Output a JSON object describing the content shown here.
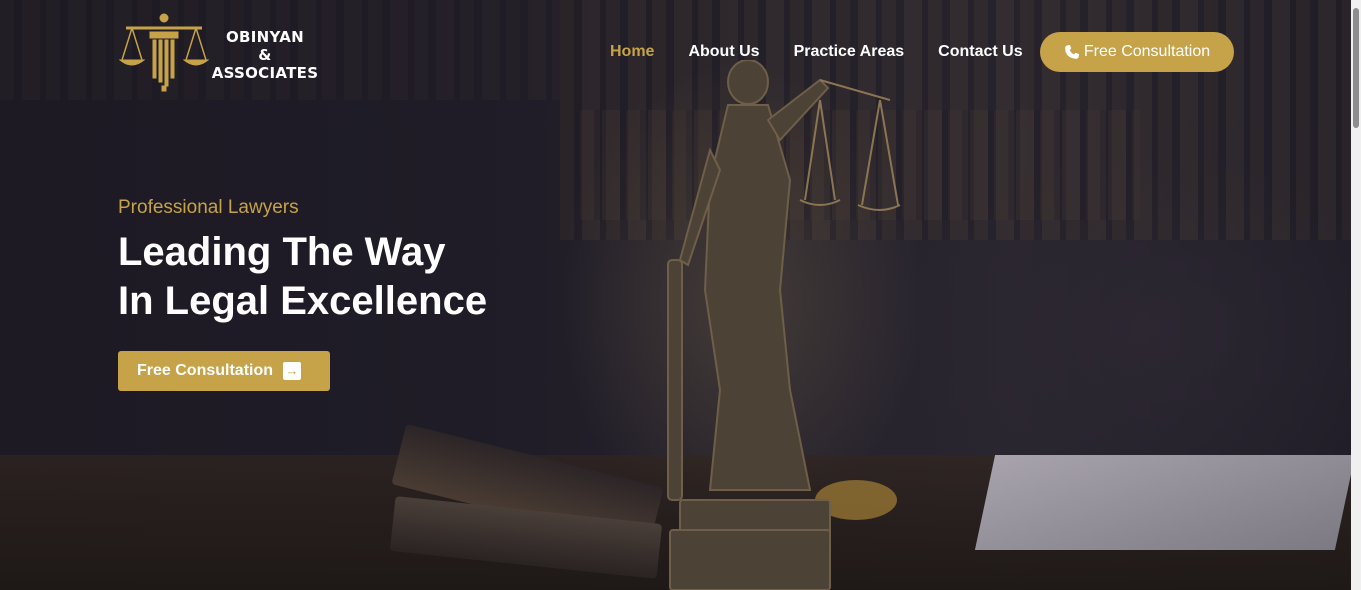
{
  "brand": {
    "name_line1": "OBINYAN",
    "name_line2": "&",
    "name_line3": "ASSOCIATES",
    "accent_color": "#c6a348",
    "logo_icon": "scales-pillar-icon"
  },
  "nav": {
    "items": [
      {
        "label": "Home",
        "active": true
      },
      {
        "label": "About Us",
        "active": false
      },
      {
        "label": "Practice Areas",
        "active": false
      },
      {
        "label": "Contact Us",
        "active": false
      }
    ],
    "cta_label": "Free Consultation",
    "cta_icon": "phone-icon"
  },
  "hero": {
    "eyebrow": "Professional Lawyers",
    "headline_line1": "Leading The Way",
    "headline_line2": "In Legal Excellence",
    "cta_label": "Free Consultation",
    "cta_icon": "arrow-right-icon"
  }
}
